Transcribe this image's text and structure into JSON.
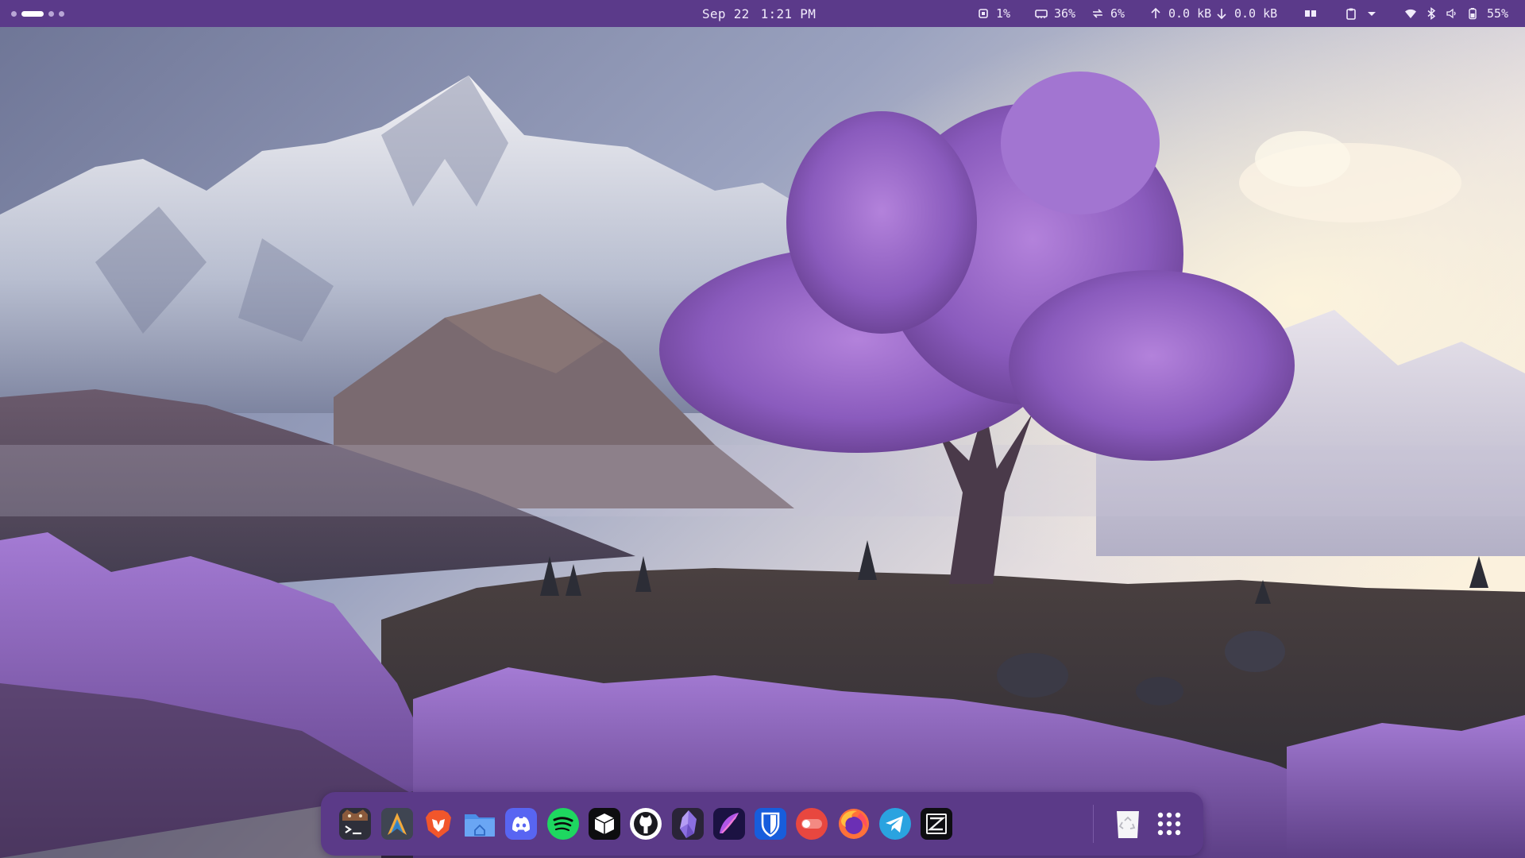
{
  "topbar": {
    "workspaces": [
      "1",
      "2",
      "3",
      "4"
    ],
    "active_workspace": 2,
    "date": "Sep 22",
    "time": "1:21 PM",
    "cpu": "1%",
    "memory": "36%",
    "swap": "6%",
    "upload": "0.0 kB",
    "download": "0.0 kB",
    "battery": "55%"
  },
  "dock": {
    "apps": [
      {
        "name": "terminal",
        "icon": "terminal-icon"
      },
      {
        "name": "arch-installer",
        "icon": "arch-icon"
      },
      {
        "name": "brave-browser",
        "icon": "brave-lion-icon"
      },
      {
        "name": "files",
        "icon": "folder-home-icon"
      },
      {
        "name": "discord",
        "icon": "discord-icon"
      },
      {
        "name": "spotify",
        "icon": "spotify-icon"
      },
      {
        "name": "cube-app",
        "icon": "cube-icon"
      },
      {
        "name": "github",
        "icon": "github-icon"
      },
      {
        "name": "obsidian",
        "icon": "obsidian-crystal-icon"
      },
      {
        "name": "notes",
        "icon": "feather-icon"
      },
      {
        "name": "bitwarden",
        "icon": "shield-icon"
      },
      {
        "name": "toggle-app",
        "icon": "toggle-icon"
      },
      {
        "name": "firefox",
        "icon": "firefox-icon"
      },
      {
        "name": "telegram",
        "icon": "telegram-icon"
      },
      {
        "name": "zed-editor",
        "icon": "zed-icon"
      },
      {
        "name": "trash",
        "icon": "trash-icon"
      },
      {
        "name": "app-grid",
        "icon": "app-grid-icon"
      }
    ]
  },
  "colors": {
    "bar": "#5b3a8a",
    "dock": "#5b3a88",
    "accent": "#9b6fd3"
  }
}
